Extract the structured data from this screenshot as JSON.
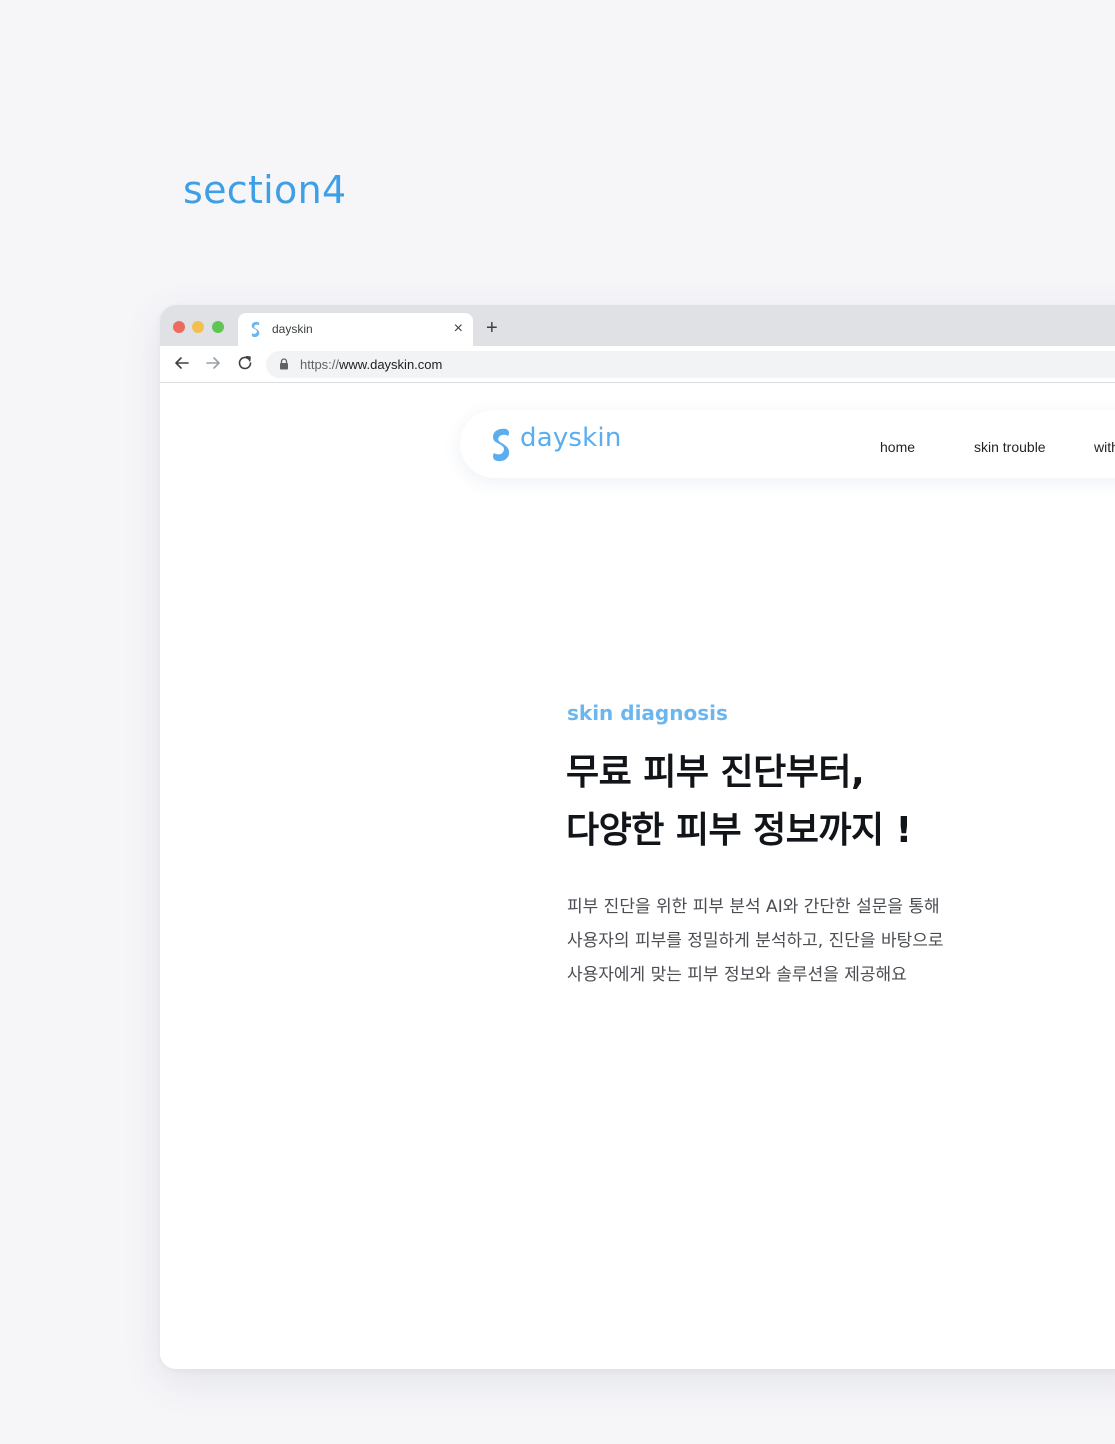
{
  "section_label": "section4",
  "browser": {
    "tab": {
      "title": "dayskin",
      "close_glyph": "×"
    },
    "new_tab_glyph": "+",
    "url": {
      "scheme": "https://",
      "host": "www.dayskin.com"
    },
    "icons": [
      "back-arrow-icon",
      "forward-arrow-icon",
      "reload-icon",
      "lock-icon",
      "dayskin-favicon-icon"
    ]
  },
  "site": {
    "logo_text": "dayskin",
    "nav": {
      "home": "home",
      "skin_trouble": "skin trouble",
      "with": "with"
    },
    "hero": {
      "eyebrow": "skin diagnosis",
      "title_lines": [
        "무료 피부 진단부터,",
        "다양한 피부 정보까지 !"
      ],
      "desc_lines": [
        "피부 진단을 위한 피부 분석 AI와 간단한 설문을 통해",
        "사용자의 피부를 정밀하게 분석하고, 진단을 바탕으로",
        "사용자에게 맞는 피부 정보와 솔루션을 제공해요"
      ]
    }
  },
  "colors": {
    "accent": "#3f9fe6",
    "logo_blue": "#5aaef0",
    "eyebrow_blue": "#6cb6f0",
    "title": "#111418",
    "body_text": "#4a4d52",
    "background": "#f6f6f9"
  }
}
